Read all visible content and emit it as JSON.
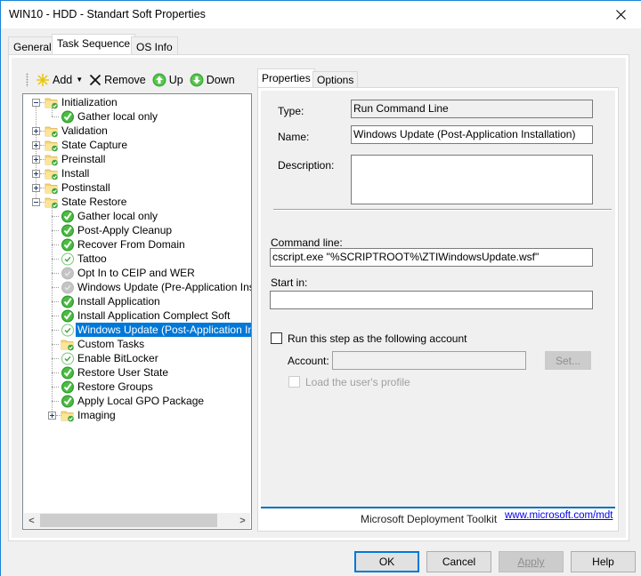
{
  "window": {
    "title": "WIN10 - HDD - Standart Soft Properties",
    "close_icon": "close-icon"
  },
  "tabs": [
    {
      "label": "General",
      "active": false
    },
    {
      "label": "Task Sequence",
      "active": true
    },
    {
      "label": "OS Info",
      "active": false
    }
  ],
  "toolbar": {
    "add_label": "Add",
    "remove_label": "Remove",
    "up_label": "Up",
    "down_label": "Down"
  },
  "tree": {
    "items": [
      {
        "label": "Initialization",
        "type": "group",
        "level": 0,
        "expander": "minus"
      },
      {
        "label": "Gather local only",
        "type": "step-enabled",
        "level": 1
      },
      {
        "label": "Validation",
        "type": "group",
        "level": 0,
        "expander": "plus"
      },
      {
        "label": "State Capture",
        "type": "group",
        "level": 0,
        "expander": "plus"
      },
      {
        "label": "Preinstall",
        "type": "group",
        "level": 0,
        "expander": "plus"
      },
      {
        "label": "Install",
        "type": "group",
        "level": 0,
        "expander": "plus"
      },
      {
        "label": "Postinstall",
        "type": "group",
        "level": 0,
        "expander": "plus"
      },
      {
        "label": "State Restore",
        "type": "group",
        "level": 0,
        "expander": "minus"
      },
      {
        "label": "Gather local only",
        "type": "step-enabled",
        "level": 1
      },
      {
        "label": "Post-Apply Cleanup",
        "type": "step-enabled",
        "level": 1
      },
      {
        "label": "Recover From Domain",
        "type": "step-enabled",
        "level": 1
      },
      {
        "label": "Tattoo",
        "type": "step-conditional",
        "level": 1
      },
      {
        "label": "Opt In to CEIP and WER",
        "type": "step-disabled",
        "level": 1
      },
      {
        "label": "Windows Update (Pre-Application Installation)",
        "type": "step-disabled",
        "level": 1
      },
      {
        "label": "Install Application",
        "type": "step-enabled",
        "level": 1
      },
      {
        "label": "Install Application Complect Soft",
        "type": "step-enabled",
        "level": 1
      },
      {
        "label": "Windows Update (Post-Application Installation)",
        "type": "step-conditional",
        "level": 1,
        "selected": true
      },
      {
        "label": "Custom Tasks",
        "type": "group",
        "level": 1
      },
      {
        "label": "Enable BitLocker",
        "type": "step-conditional",
        "level": 1
      },
      {
        "label": "Restore User State",
        "type": "step-enabled",
        "level": 1
      },
      {
        "label": "Restore Groups",
        "type": "step-enabled",
        "level": 1
      },
      {
        "label": "Apply Local GPO Package",
        "type": "step-enabled",
        "level": 1
      },
      {
        "label": "Imaging",
        "type": "group",
        "level": 1,
        "expander": "plus"
      }
    ]
  },
  "properties": {
    "tabs": [
      {
        "label": "Properties",
        "active": true
      },
      {
        "label": "Options",
        "active": false
      }
    ],
    "type_label": "Type:",
    "type_value": "Run Command Line",
    "name_label": "Name:",
    "name_value": "Windows Update (Post-Application Installation)",
    "description_label": "Description:",
    "description_value": "",
    "command_line_label": "Command line:",
    "command_line_value": "cscript.exe \"%SCRIPTROOT%\\ZTIWindowsUpdate.wsf\"",
    "start_in_label": "Start in:",
    "start_in_value": "",
    "run_as_label": "Run this step as the following account",
    "run_as_checked": false,
    "account_label": "Account:",
    "account_value": "",
    "set_button": "Set...",
    "load_profile_label": "Load the user's profile",
    "load_profile_checked": false,
    "footer_brand": "Microsoft Deployment Toolkit",
    "footer_link": "www.microsoft.com/mdt"
  },
  "buttons": {
    "ok": "OK",
    "cancel": "Cancel",
    "apply": "Apply",
    "help": "Help"
  },
  "colors": {
    "accent": "#0078d7",
    "selection": "#0078d7",
    "window_border": "#1883d7",
    "footer_rule": "#0070c0"
  }
}
